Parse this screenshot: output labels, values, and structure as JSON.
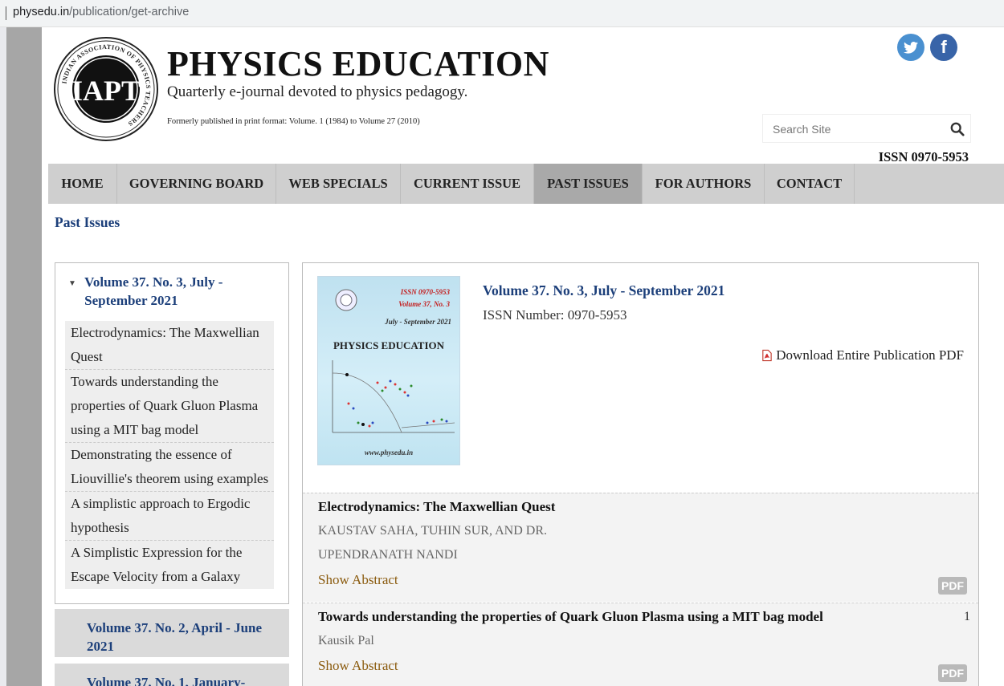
{
  "browser": {
    "url_host": "physedu.in",
    "url_path": "/publication/get-archive"
  },
  "header": {
    "site_title": "PHYSICS EDUCATION",
    "tagline": "Quarterly e-journal devoted to physics pedagogy.",
    "formerly": "Formerly published in print format: Volume. 1 (1984) to Volume 27 (2010)",
    "issn": "ISSN 0970-5953",
    "logo_text": "IAPT",
    "logo_ring_text": "INDIAN ASSOCIATION OF PHYSICS TEACHERS",
    "social": {
      "twitter_icon": "twitter-icon",
      "facebook_icon": "facebook-icon",
      "facebook_glyph": "f"
    }
  },
  "search": {
    "placeholder": "Search Site",
    "icon": "search-icon"
  },
  "nav": {
    "items": [
      {
        "label": "HOME"
      },
      {
        "label": "GOVERNING BOARD"
      },
      {
        "label": "WEB SPECIALS"
      },
      {
        "label": "CURRENT ISSUE"
      },
      {
        "label": "PAST ISSUES",
        "active": true
      },
      {
        "label": "FOR AUTHORS"
      },
      {
        "label": "CONTACT"
      }
    ]
  },
  "page": {
    "heading": "Past Issues"
  },
  "sidebar": {
    "current_volume": {
      "title": "Volume 37. No. 3, July - September 2021",
      "articles": [
        "Electrodynamics: The Maxwellian Quest",
        "Towards understanding the properties of Quark Gluon Plasma using a MIT bag model",
        "Demonstrating the essence of Liouvillie's theorem using examples",
        "A simplistic approach to Ergodic hypothesis",
        "A Simplistic Expression for the Escape Velocity from a Galaxy"
      ]
    },
    "other_volumes": [
      "Volume 37. No. 2, April - June 2021",
      "Volume 37. No. 1, January-"
    ]
  },
  "issue": {
    "title": "Volume 37. No. 3, July - September 2021",
    "issn_line": "ISSN Number: 0970-5953",
    "download_label": "Download Entire Publication PDF",
    "cover": {
      "issn": "ISSN 0970-5953",
      "volume": "Volume 37, No. 3",
      "date": "July - September 2021",
      "title": "PHYSICS EDUCATION",
      "url": "www.physedu.in"
    }
  },
  "articles": [
    {
      "title": "Electrodynamics: The Maxwellian Quest",
      "authors_line1": "KAUSTAV SAHA, TUHIN SUR, AND DR.",
      "authors_line2": "UPENDRANATH NANDI",
      "show_abstract": "Show Abstract",
      "pdf_label": "PDF"
    },
    {
      "title": "Towards understanding the properties of Quark Gluon Plasma using a MIT bag model",
      "page": "1",
      "authors_line1": "Kausik Pal",
      "show_abstract": "Show Abstract",
      "pdf_label": "PDF"
    }
  ]
}
